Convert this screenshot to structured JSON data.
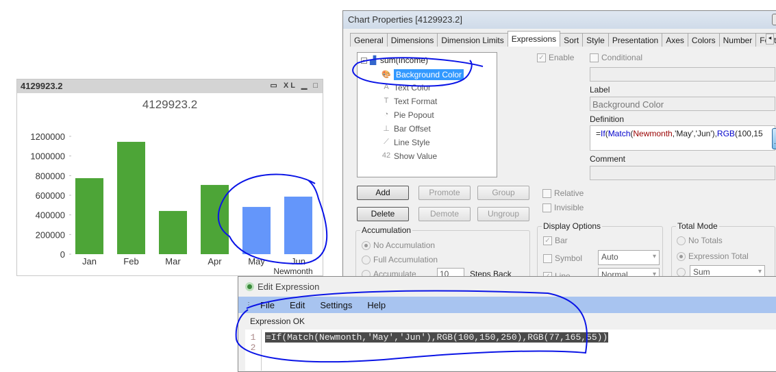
{
  "chart_window": {
    "title": "4129923.2",
    "icons": [
      "print-icon",
      "xl-export-icon",
      "minimize-icon",
      "maximize-icon"
    ],
    "xl_label": "XL"
  },
  "chart_data": {
    "type": "bar",
    "title": "4129923.2",
    "xlabel": "Newmonth",
    "ylabel": "",
    "categories": [
      "Jan",
      "Feb",
      "Mar",
      "Apr",
      "May",
      "Jun"
    ],
    "values": [
      774000,
      1144000,
      440000,
      705000,
      481000,
      586000
    ],
    "colors": [
      "#4da537",
      "#4da537",
      "#4da537",
      "#4da537",
      "#6496fa",
      "#6496fa"
    ],
    "yticks": [
      "0",
      "200000",
      "400000",
      "600000",
      "800000",
      "1000000",
      "1200000"
    ],
    "ylim": [
      0,
      1200000
    ],
    "grid": false,
    "legend": "none"
  },
  "properties": {
    "title": "Chart Properties [4129923.2]",
    "tabs": [
      "General",
      "Dimensions",
      "Dimension Limits",
      "Expressions",
      "Sort",
      "Style",
      "Presentation",
      "Axes",
      "Colors",
      "Number",
      "Font"
    ],
    "active_tab": "Expressions",
    "tree": {
      "root": "sum(Income)",
      "items": [
        "Background Color",
        "Text Color",
        "Text Format",
        "Pie Popout",
        "Bar Offset",
        "Line Style",
        "Show Value"
      ],
      "selected": "Background Color"
    },
    "buttons": {
      "add": "Add",
      "promote": "Promote",
      "group": "Group",
      "delete": "Delete",
      "demote": "Demote",
      "ungroup": "Ungroup"
    },
    "enable_label": "Enable",
    "enable_checked": true,
    "conditional_label": "Conditional",
    "conditional_checked": false,
    "label_caption": "Label",
    "label_value": "Background Color",
    "definition_caption": "Definition",
    "definition_parts": {
      "eq": "=",
      "f1": "If",
      "p1": "(",
      "f2": "Match",
      "p2": "(",
      "field": "Newmonth",
      "args": ",'May','Jun'),",
      "f3": "RGB",
      "rest": "(100,15"
    },
    "definition_button": "...",
    "comment_caption": "Comment",
    "relative_label": "Relative",
    "invisible_label": "Invisible",
    "accumulation": {
      "title": "Accumulation",
      "options": [
        "No Accumulation",
        "Full Accumulation",
        "Accumulate"
      ],
      "selected": "No Accumulation",
      "steps_value": "10",
      "steps_label": "Steps Back"
    },
    "display_options": {
      "title": "Display Options",
      "bar_label": "Bar",
      "bar_checked": true,
      "symbol_label": "Symbol",
      "symbol_value": "Auto",
      "line_label": "Line",
      "line_value": "Normal"
    },
    "total_mode": {
      "title": "Total Mode",
      "options": [
        "No Totals",
        "Expression Total"
      ],
      "selected": "Expression Total",
      "aggregate_value": "Sum"
    }
  },
  "edit_expression": {
    "title": "Edit Expression",
    "menu": [
      "File",
      "Edit",
      "Settings",
      "Help"
    ],
    "status": "Expression OK",
    "line_numbers": [
      "1",
      "2"
    ],
    "code": "=If(Match(Newmonth,'May','Jun'),RGB(100,150,250),RGB(77,165,55))"
  },
  "annotation_color": "#0a14e6"
}
